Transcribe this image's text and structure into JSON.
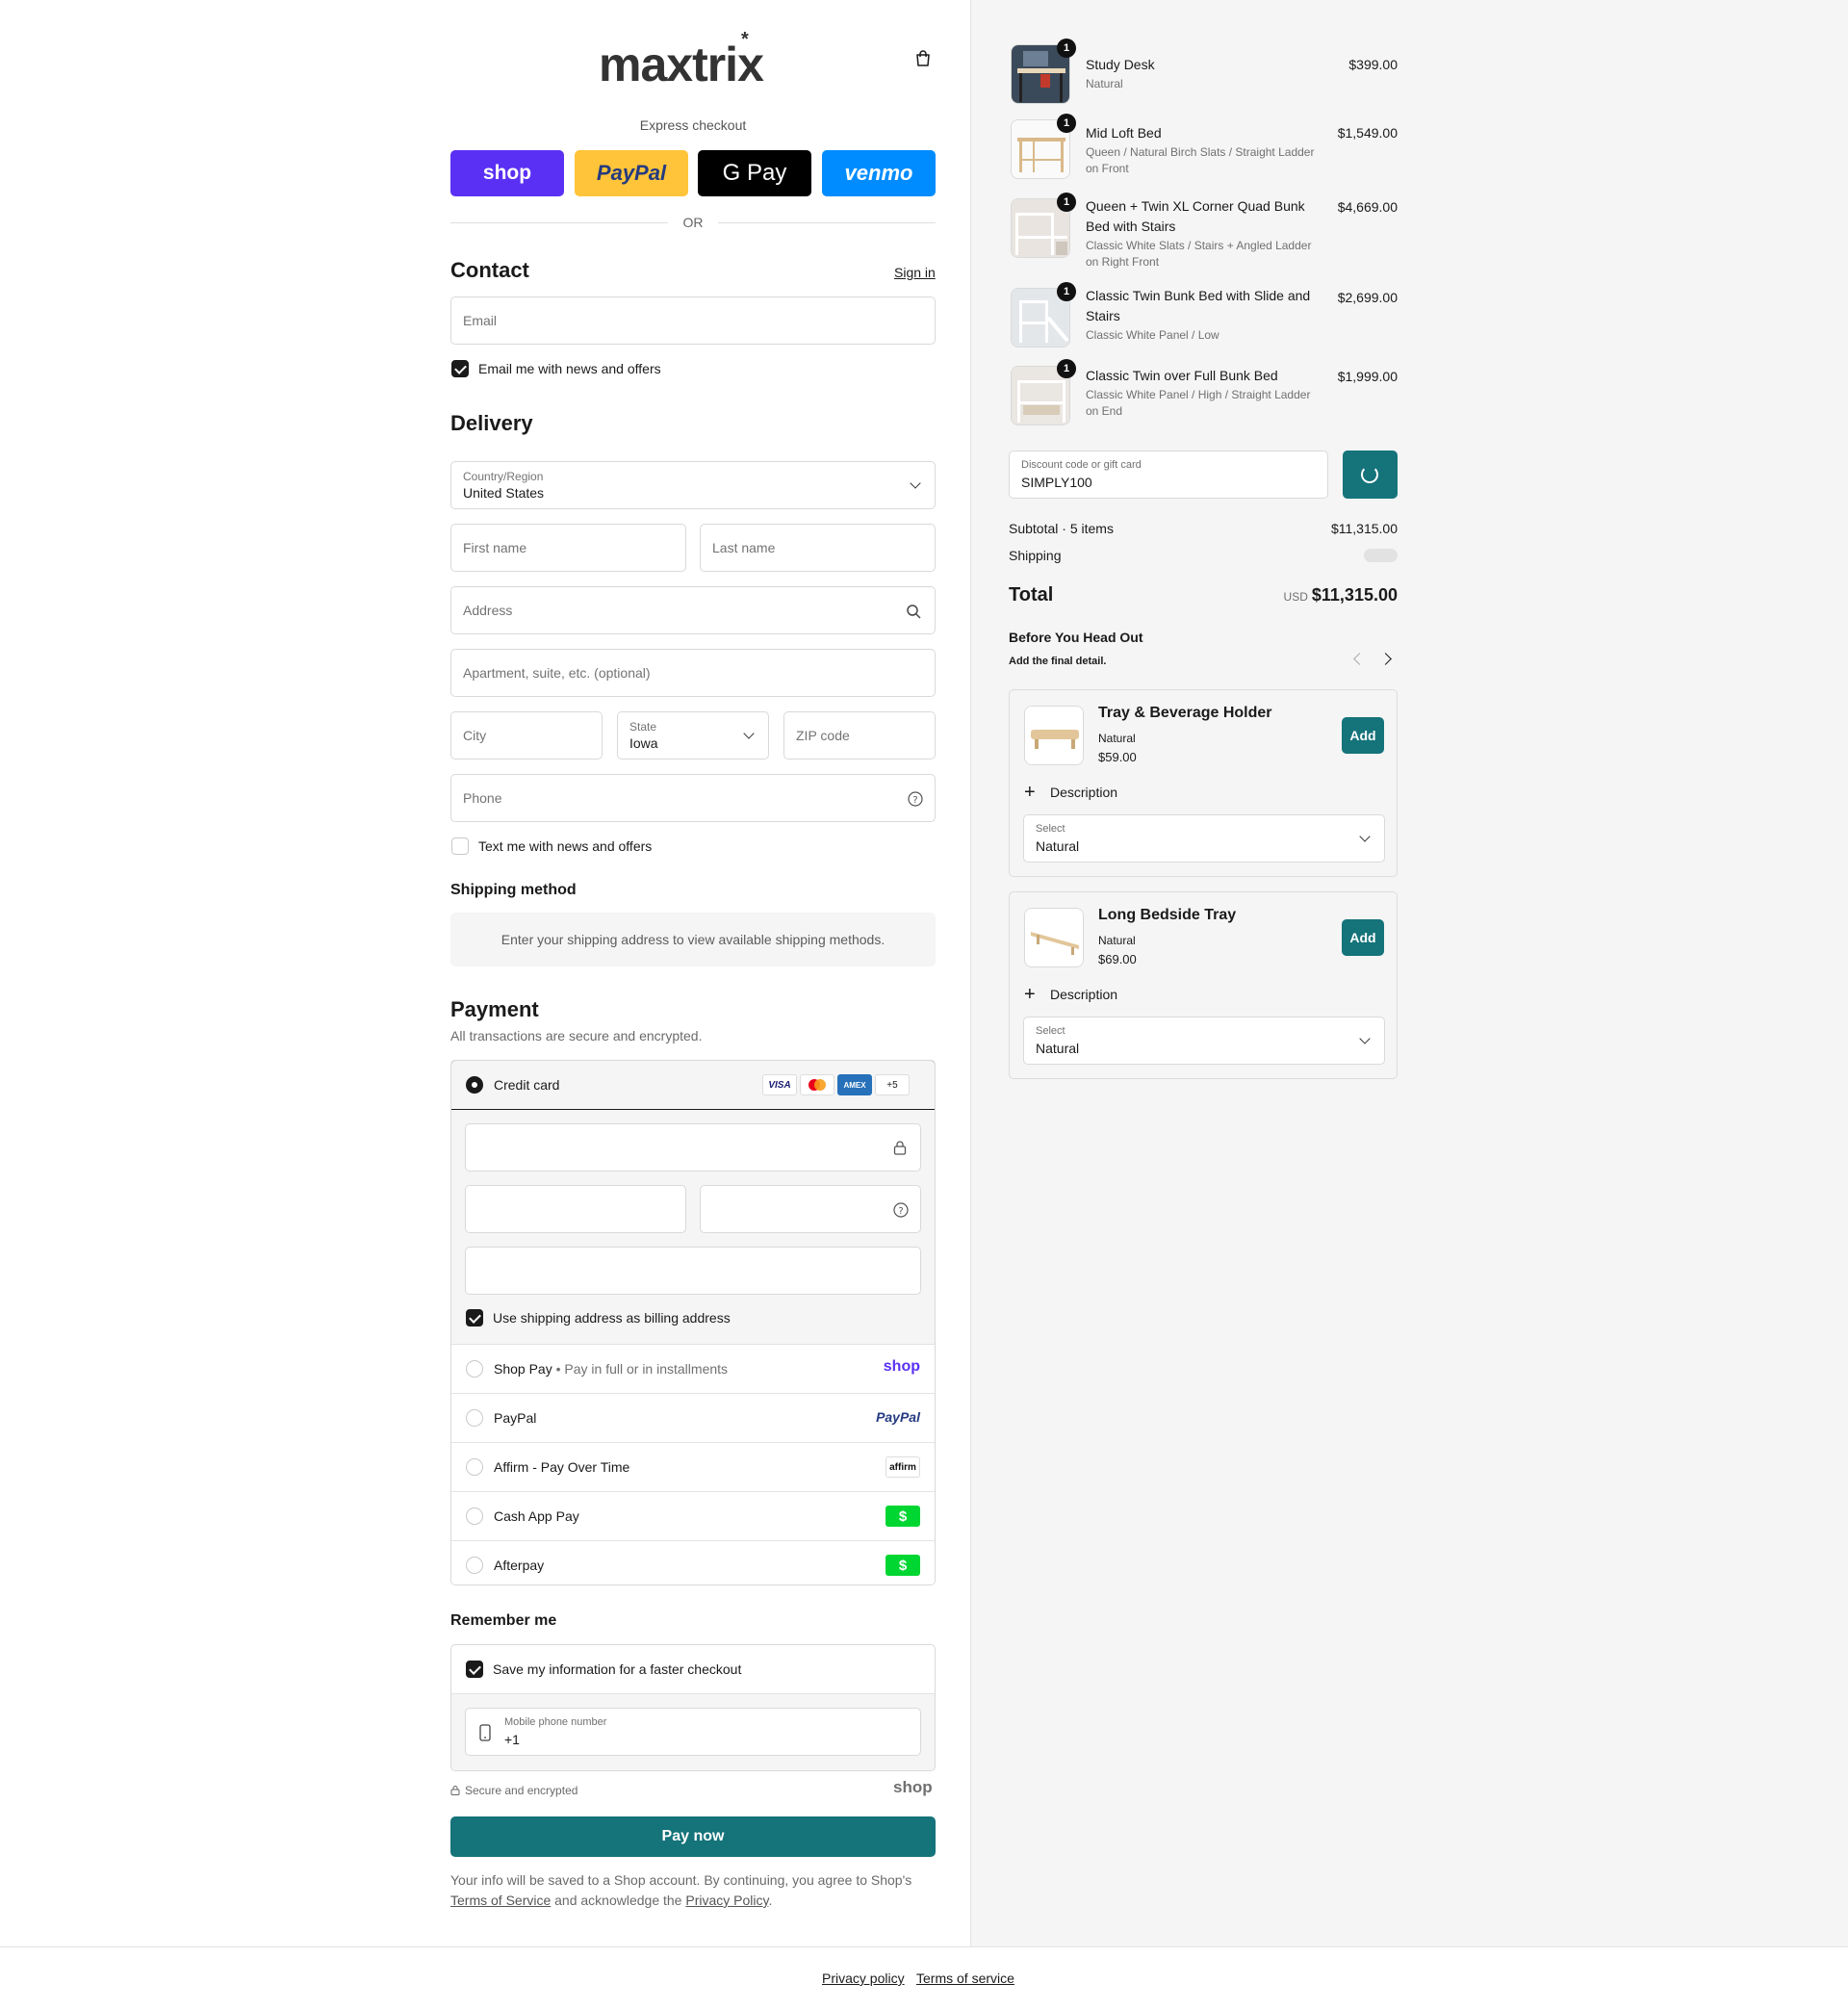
{
  "brand": {
    "logo": "maxtrix",
    "logo_mark": "*"
  },
  "express": {
    "label": "Express checkout",
    "shop": "shop",
    "paypal": "PayPal",
    "gpay": "G Pay",
    "venmo": "venmo",
    "or": "OR"
  },
  "contact": {
    "heading": "Contact",
    "signin": "Sign in",
    "email_placeholder": "Email",
    "news_label": "Email me with news and offers",
    "news_checked": true
  },
  "delivery": {
    "heading": "Delivery",
    "country_label": "Country/Region",
    "country_value": "United States",
    "first_name": "First name",
    "last_name": "Last name",
    "address": "Address",
    "apartment": "Apartment, suite, etc. (optional)",
    "city": "City",
    "state_label": "State",
    "state_value": "Iowa",
    "zip": "ZIP code",
    "phone": "Phone",
    "text_label": "Text me with news and offers",
    "text_checked": false
  },
  "shipping": {
    "heading": "Shipping method",
    "message": "Enter your shipping address to view available shipping methods."
  },
  "payment": {
    "heading": "Payment",
    "subtitle": "All transactions are secure and encrypted.",
    "credit_card": "Credit card",
    "badges": [
      "VISA",
      "●●",
      "AMEX",
      "+5"
    ],
    "billing_label": "Use shipping address as billing address",
    "billing_checked": true,
    "options": [
      {
        "label": "Shop Pay",
        "sub": " • Pay in full or in installments",
        "logo": "shop"
      },
      {
        "label": "PayPal",
        "sub": "",
        "logo": "PayPal"
      },
      {
        "label": "Affirm - Pay Over Time",
        "sub": "",
        "logo": "affirm"
      },
      {
        "label": "Cash App Pay",
        "sub": "",
        "logo": "$"
      },
      {
        "label": "Afterpay",
        "sub": "",
        "logo": "$"
      }
    ]
  },
  "remember": {
    "heading": "Remember me",
    "save_label": "Save my information for a faster checkout",
    "save_checked": true,
    "phone_label": "Mobile phone number",
    "phone_value": "+1",
    "secure": "Secure and encrypted",
    "shop_logo": "shop"
  },
  "pay_now": "Pay now",
  "legal": {
    "pre": "Your info will be saved to a Shop account. By continuing, you agree to Shop's ",
    "terms": "Terms of Service",
    "mid": " and acknowledge the ",
    "privacy": "Privacy Policy",
    "post": "."
  },
  "cart": {
    "items": [
      {
        "qty": "1",
        "name": "Study Desk",
        "variant": "Natural",
        "price": "$399.00"
      },
      {
        "qty": "1",
        "name": "Mid Loft Bed",
        "variant": "Queen / Natural Birch Slats / Straight Ladder on Front",
        "price": "$1,549.00"
      },
      {
        "qty": "1",
        "name": "Queen + Twin XL Corner Quad Bunk Bed with Stairs",
        "variant": "Classic White Slats / Stairs + Angled Ladder on Right Front",
        "price": "$4,669.00"
      },
      {
        "qty": "1",
        "name": "Classic Twin Bunk Bed with Slide and Stairs",
        "variant": "Classic White Panel / Low",
        "price": "$2,699.00"
      },
      {
        "qty": "1",
        "name": "Classic Twin over Full Bunk Bed",
        "variant": "Classic White Panel / High / Straight Ladder on End",
        "price": "$1,999.00"
      }
    ],
    "discount_label": "Discount code or gift card",
    "discount_value": "SIMPLY100",
    "subtotal_label": "Subtotal · 5 items",
    "subtotal_value": "$11,315.00",
    "shipping_label": "Shipping",
    "total_label": "Total",
    "currency": "USD",
    "total_value": "$11,315.00"
  },
  "upsell": {
    "heading": "Before You Head Out",
    "subheading": "Add the final detail.",
    "products": [
      {
        "name": "Tray & Beverage Holder",
        "variant": "Natural",
        "price": "$59.00",
        "add": "Add",
        "desc": "Description",
        "select_label": "Select",
        "select_value": "Natural"
      },
      {
        "name": "Long Bedside Tray",
        "variant": "Natural",
        "price": "$69.00",
        "add": "Add",
        "desc": "Description",
        "select_label": "Select",
        "select_value": "Natural"
      }
    ]
  },
  "footer": {
    "privacy": "Privacy policy",
    "terms": "Terms of service"
  },
  "colors": {
    "accent": "#15737a",
    "shop": "#5a31f4",
    "paypal": "#ffc439",
    "venmo": "#008cff"
  }
}
